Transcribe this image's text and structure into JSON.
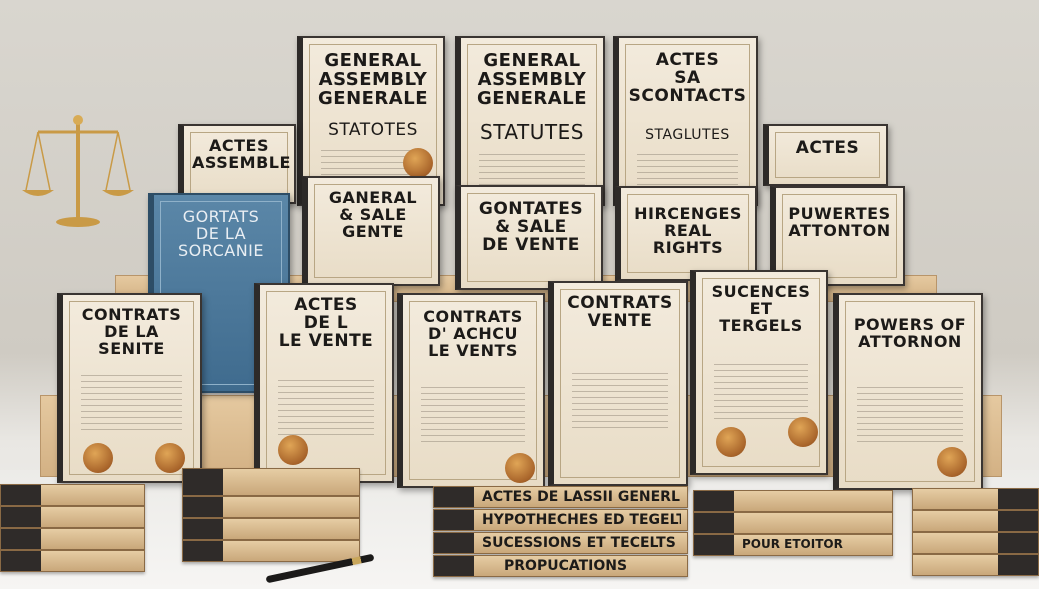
{
  "documents": {
    "row_top": [
      {
        "title": "GENERAL\nASSEMBLY\nGENERALE",
        "subtitle": "STATOTES"
      },
      {
        "title": "GENERAL\nASSEMBLY\nGENERALE",
        "subtitle": "STATUTES"
      },
      {
        "title": "ACTES\nSA\nSCONTACTS",
        "subtitle": "STAGLUTES"
      }
    ],
    "row_mid": [
      {
        "title": "ACTES\nASSEMBLE"
      },
      {
        "title": "GORTATS\nDE LA\nSORCANIE"
      },
      {
        "title": "GANERAL\n& SALE\nGENTE"
      },
      {
        "title": "GONTATES\n& SALE\nDE VENTE"
      },
      {
        "title": "HIRCENGES\nREAL RIGHTS"
      },
      {
        "title": "ACTES"
      },
      {
        "title": "PUWERTES\nATTONTON"
      }
    ],
    "row_front": [
      {
        "title": "CONTRATS\nDE LA\nSENITE"
      },
      {
        "title": "ACTES\nDE L\nLE VENTE"
      },
      {
        "title": "CONTRATS\nD' ACHCU\nLE VENTS"
      },
      {
        "title": "CONTRATS\nVENTE"
      },
      {
        "title": "SUCENCES\nET\nTERGELS"
      },
      {
        "title": "POWERS OF\nATTORNON"
      }
    ]
  },
  "book_stack_center": [
    "ACTES DE LASSII GENERLE",
    "HYPOTHECHES ED TEGELTS",
    "SUCESSIONS ET TECELTS",
    "PROPUCATIONS"
  ],
  "book_stack_right_label": "POUR ETOITOR",
  "colors": {
    "paper": "#f3ebdd",
    "spine": "#2d2a28",
    "seal": "#a8642a",
    "blue_binder": "#4a7699",
    "wood": "#d7b588"
  },
  "icons": [
    "scales-of-justice-icon",
    "fountain-pen-icon",
    "wax-seal-icon"
  ]
}
